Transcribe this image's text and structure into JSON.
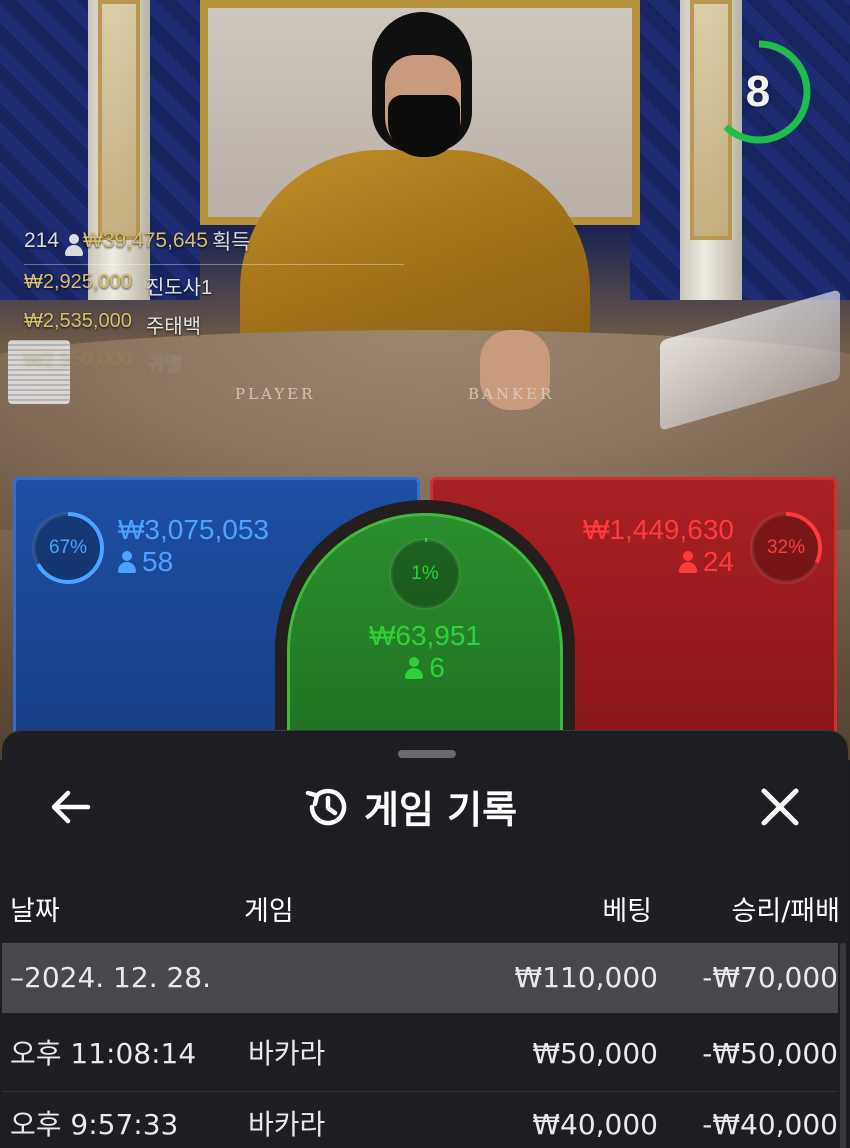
{
  "timer": {
    "value": "8",
    "remaining_fraction": 0.62,
    "color": "#1fbd4a"
  },
  "winners": {
    "count": "214",
    "total": "₩39,475,645",
    "total_suffix": "획득",
    "rows": [
      {
        "amount": "₩2,925,000",
        "name": "진도사1"
      },
      {
        "amount": "₩2,535,000",
        "name": "주태백"
      },
      {
        "amount": "₩2,350,000",
        "name": "귀멸"
      }
    ]
  },
  "table_labels": {
    "player": "PLAYER",
    "banker": "BANKER"
  },
  "bets": {
    "player": {
      "percent": "67%",
      "fraction": 0.67,
      "amount": "₩3,075,053",
      "players": "58",
      "color": "#4da3ff"
    },
    "banker": {
      "percent": "32%",
      "fraction": 0.32,
      "amount": "₩1,449,630",
      "players": "24",
      "color": "#ff3b3b"
    },
    "tie": {
      "percent": "1%",
      "fraction": 0.01,
      "amount": "₩63,951",
      "players": "6",
      "color": "#2fd13a"
    }
  },
  "history": {
    "title": "게임 기록",
    "columns": {
      "date": "날짜",
      "game": "게임",
      "bet": "베팅",
      "result": "승리/패배"
    },
    "date_group": {
      "label": "–2024. 12. 28.",
      "bet": "₩110,000",
      "result": "-₩70,000"
    },
    "rows": [
      {
        "time": "오후 11:08:14",
        "game": "바카라",
        "bet": "₩50,000",
        "result": "-₩50,000"
      },
      {
        "time": "오후 9:57:33",
        "game": "바카라",
        "bet": "₩40,000",
        "result": "-₩40,000"
      }
    ]
  }
}
